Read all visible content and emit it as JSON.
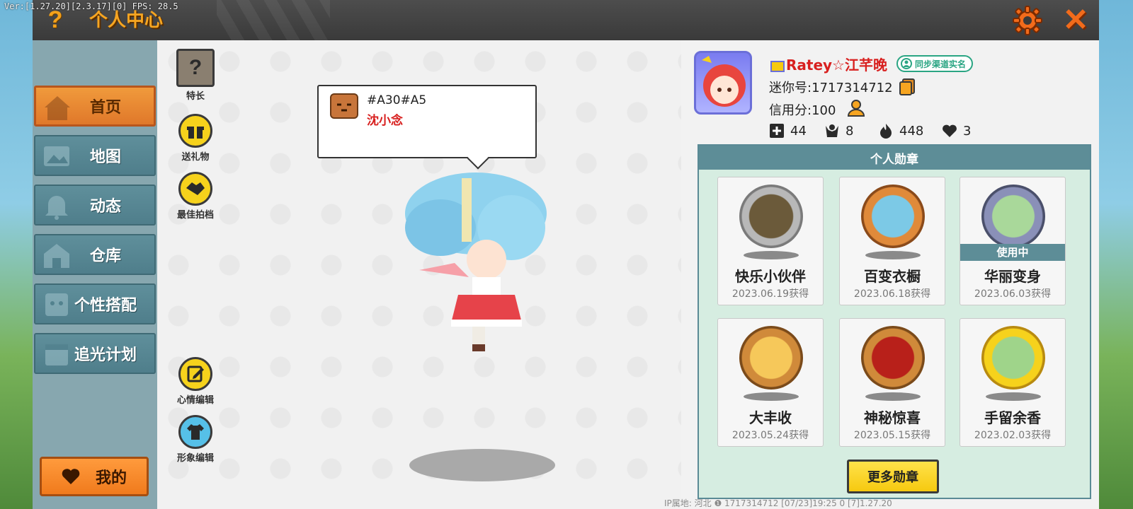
{
  "debug": {
    "version_text": "Ver:[1.27.20][2.3.17][0] FPS: 28.5"
  },
  "header": {
    "title": "个人中心",
    "help_label": "?"
  },
  "sidebar": {
    "items": [
      {
        "label": "首页",
        "active": true
      },
      {
        "label": "地图"
      },
      {
        "label": "动态"
      },
      {
        "label": "仓库"
      },
      {
        "label": "个性搭配"
      },
      {
        "label": "追光计划"
      }
    ],
    "mine_label": "我的"
  },
  "actions": {
    "talent": "特长",
    "gift": "送礼物",
    "partner": "最佳拍档",
    "mood": "心情编辑",
    "appearance": "形象编辑"
  },
  "bubble": {
    "code": "#A30#A5",
    "name": "沈小念"
  },
  "footer": {
    "info": "IP属地: 河北 ❶      1717314712    [07/23]19:25 0  [7]1.27.20"
  },
  "profile": {
    "name": "Ratey☆江芊晚",
    "verify_label": "同步渠道实名",
    "uid_line": "迷你号:1717314712",
    "credit_line": "信用分:100",
    "stats": {
      "plus": "44",
      "fans": "8",
      "fire": "448",
      "hearts": "3"
    }
  },
  "medals": {
    "header": "个人勋章",
    "in_use_label": "使用中",
    "items": [
      {
        "name": "快乐小伙伴",
        "date": "2023.06.19获得"
      },
      {
        "name": "百变衣橱",
        "date": "2023.06.18获得"
      },
      {
        "name": "华丽变身",
        "date": "2023.06.03获得"
      },
      {
        "name": "大丰收",
        "date": "2023.05.24获得"
      },
      {
        "name": "神秘惊喜",
        "date": "2023.05.15获得"
      },
      {
        "name": "手留余香",
        "date": "2023.02.03获得"
      }
    ],
    "more_label": "更多勋章"
  },
  "colors": {
    "accent_orange": "#f6a521",
    "nav_teal": "#5d8d97",
    "name_red": "#d8201f",
    "verify_green": "#2aa583",
    "button_yellow": "#f6c910"
  }
}
